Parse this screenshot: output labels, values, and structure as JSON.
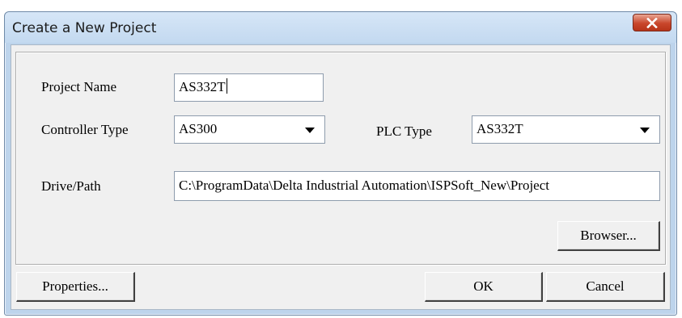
{
  "window": {
    "title": "Create a New Project",
    "close_icon": "close-icon"
  },
  "form": {
    "project_name_label": "Project Name",
    "project_name_value": "AS332T",
    "controller_type_label": "Controller Type",
    "controller_type_value": "AS300",
    "plc_type_label": "PLC Type",
    "plc_type_value": "AS332T",
    "drive_path_label": "Drive/Path",
    "drive_path_value": "C:\\ProgramData\\Delta Industrial Automation\\ISPSoft_New\\Project"
  },
  "buttons": {
    "browser": "Browser...",
    "properties": "Properties...",
    "ok": "OK",
    "cancel": "Cancel"
  },
  "colors": {
    "close_button": "#c9462b",
    "frame": "#bdd4ec",
    "client": "#f0f0f0"
  }
}
